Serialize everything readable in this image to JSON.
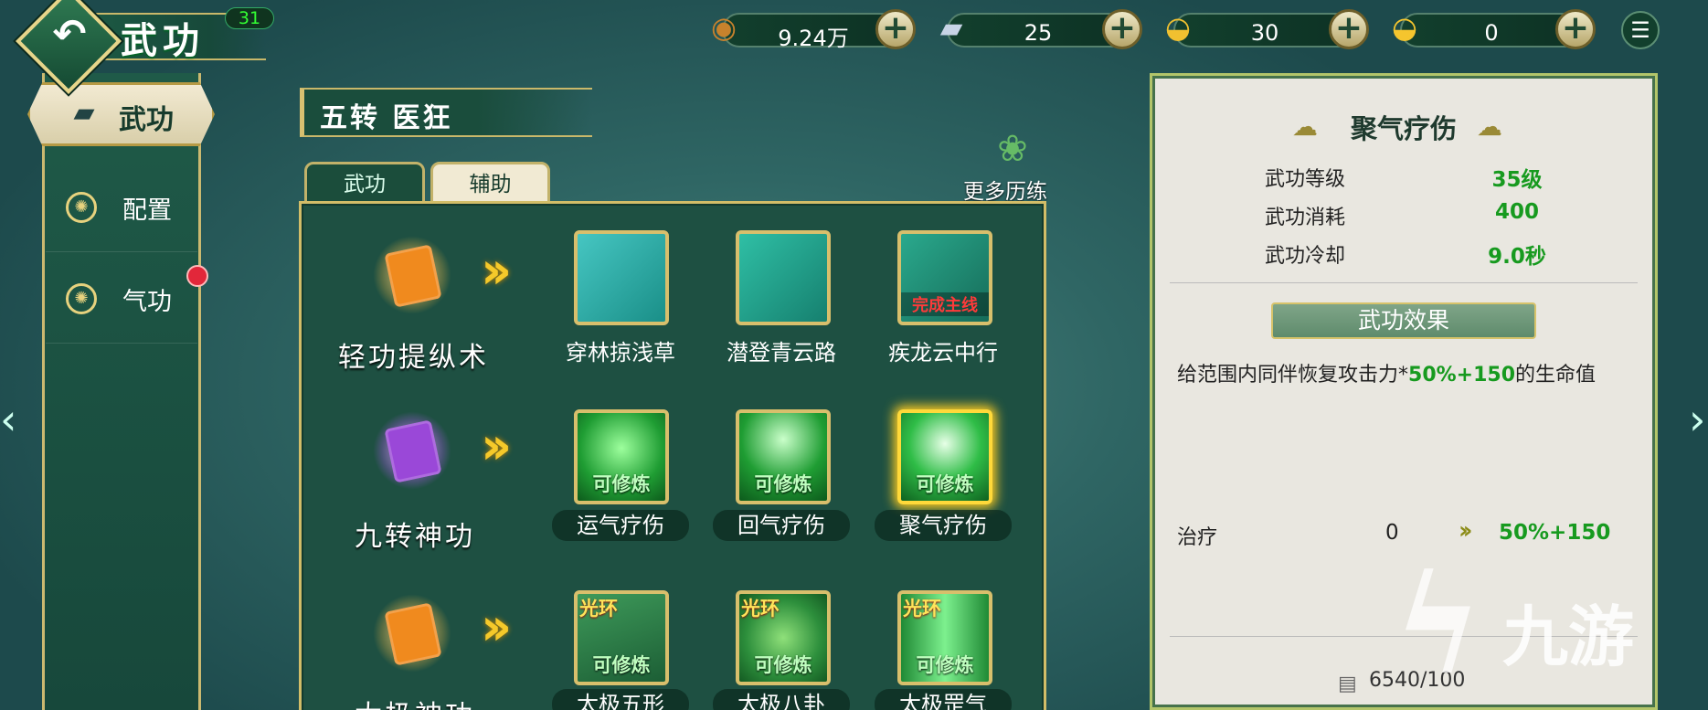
{
  "header": {
    "title": "武功",
    "level": "31",
    "back_icon": "back-arrow-icon"
  },
  "resources": [
    {
      "name": "coin",
      "icon": "copper-coin-icon",
      "value": "9.24万"
    },
    {
      "name": "silver",
      "icon": "silver-ingot-icon",
      "value": "25"
    },
    {
      "name": "bound-gold",
      "icon": "locked-gold-ingot-icon",
      "value": "30"
    },
    {
      "name": "gold",
      "icon": "gold-ingot-icon",
      "value": "0"
    }
  ],
  "nav": {
    "active": {
      "label": "武功",
      "icon": "cards-icon"
    },
    "items": [
      {
        "label": "配置",
        "icon": "swirl-icon"
      },
      {
        "label": "气功",
        "icon": "swirl-icon",
        "badge": true
      }
    ]
  },
  "subtitle": "五转 医狂",
  "more_practice": "更多历练",
  "tabs": [
    {
      "label": "武功"
    },
    {
      "label": "辅助"
    }
  ],
  "rows": [
    {
      "label": "轻功提纵术",
      "book_color": "#f08a1e",
      "skills": [
        {
          "name": "穿林掠浅草",
          "bg": "#2bb3a8",
          "top": "",
          "cap": "",
          "red": ""
        },
        {
          "name": "潜登青云路",
          "bg": "#1a9d8e",
          "top": "",
          "cap": "",
          "red": ""
        },
        {
          "name": "疾龙云中行",
          "bg": "#1b8c77",
          "top": "",
          "cap": "",
          "red": "完成主线"
        }
      ]
    },
    {
      "label": "九转神功",
      "book_color": "#9a48d8",
      "skills": [
        {
          "name": "运气疗伤",
          "bg": "#25b43a",
          "top": "",
          "cap": "可修炼",
          "red": ""
        },
        {
          "name": "回气疗伤",
          "bg": "#1f9f33",
          "top": "",
          "cap": "可修炼",
          "red": ""
        },
        {
          "name": "聚气疗伤",
          "bg": "#30c14a",
          "top": "",
          "cap": "可修炼",
          "red": ""
        }
      ]
    },
    {
      "label": "太极神功",
      "book_color": "#f08a1e",
      "skills": [
        {
          "name": "太极五形",
          "bg": "#2c8f4a",
          "top": "光环",
          "cap": "可修炼",
          "red": ""
        },
        {
          "name": "太极八卦",
          "bg": "#3aa248",
          "top": "光环",
          "cap": "可修炼",
          "red": ""
        },
        {
          "name": "太极罡气",
          "bg": "#33b244",
          "top": "光环",
          "cap": "可修炼",
          "red": ""
        }
      ]
    }
  ],
  "detail": {
    "title": "聚气疗伤",
    "stats": [
      {
        "label": "武功等级",
        "value": "35级"
      },
      {
        "label": "武功消耗",
        "value": "400"
      },
      {
        "label": "武功冷却",
        "value": "9.0秒"
      }
    ],
    "effect_header": "武功效果",
    "desc_prefix": "给范围内同伴恢复攻击力*",
    "desc_value": "50%+150",
    "desc_suffix": "的生命值",
    "heal_label": "治疗",
    "heal_current": "0",
    "heal_next": "50%+150",
    "cost": "6540/100"
  },
  "watermark": {
    "text": "九游"
  }
}
